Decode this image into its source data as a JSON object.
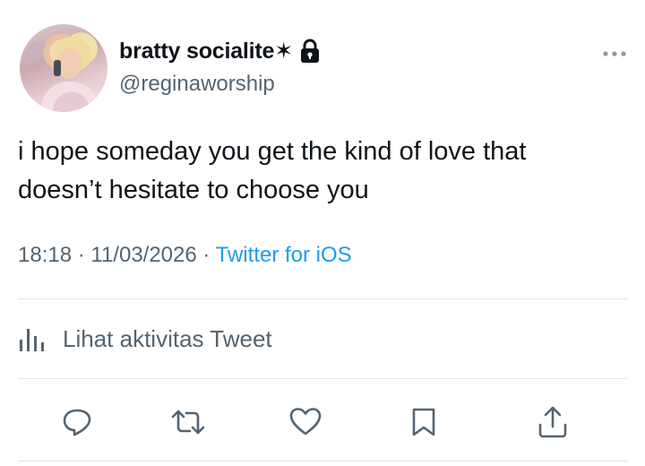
{
  "user": {
    "display_name": "bratty socialite✶",
    "handle": "@reginaworship",
    "avatar_icon": "avatar",
    "protected_icon": "lock-icon"
  },
  "tweet": {
    "text": "i hope someday you get the kind of love that\ndoesn’t hesitate to choose you",
    "time": "18:18",
    "separator": " · ",
    "date": "11/03/2026",
    "source": "Twitter for iOS"
  },
  "activity": {
    "label": "Lihat aktivitas Tweet",
    "icon": "analytics-bars-icon"
  },
  "actions": [
    "reply-icon",
    "retweet-icon",
    "like-icon",
    "bookmark-icon",
    "share-icon"
  ],
  "colors": {
    "text": "#0f1419",
    "secondary": "#536471",
    "link": "#1d9bf0",
    "divider": "#e1e6ea"
  }
}
